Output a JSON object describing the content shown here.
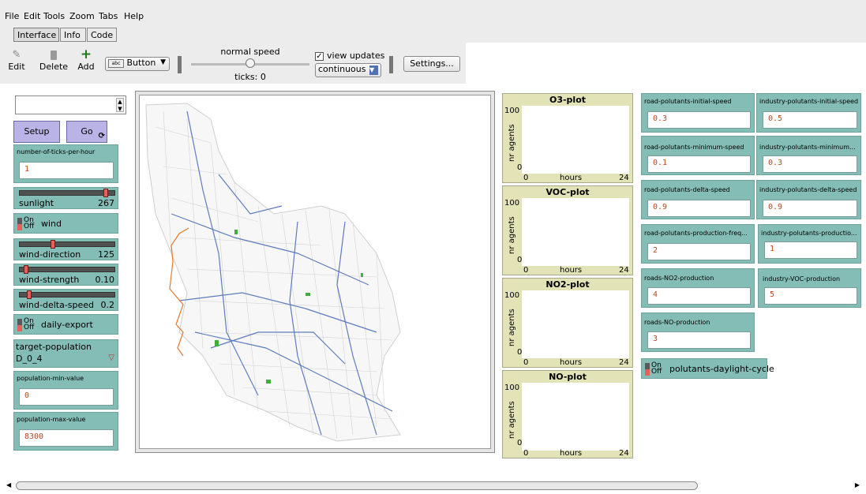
{
  "menu": [
    "File",
    "Edit",
    "Tools",
    "Zoom",
    "Tabs",
    "Help"
  ],
  "tabs": [
    "Interface",
    "Info",
    "Code"
  ],
  "toolbar": {
    "edit": "Edit",
    "delete": "Delete",
    "add": "Add",
    "widget_type": "Button",
    "speed_label": "normal speed",
    "ticks_label": "ticks: 0",
    "view_updates_label": "view updates",
    "view_updates_checked": true,
    "update_mode": "continuous",
    "settings": "Settings..."
  },
  "command_center": "",
  "buttons": {
    "setup": "Setup",
    "go": "Go"
  },
  "inputs_left": [
    {
      "label": "number-of-ticks-per-hour",
      "value": "1"
    },
    {
      "label": "population-min-value",
      "value": "0"
    },
    {
      "label": "population-max-value",
      "value": "8300"
    }
  ],
  "sliders": [
    {
      "label": "sunlight",
      "value": "267",
      "fraction": 0.9
    },
    {
      "label": "wind-direction",
      "value": "125",
      "fraction": 0.35
    },
    {
      "label": "wind-strength",
      "value": "0.10",
      "fraction": 0.05
    },
    {
      "label": "wind-delta-speed",
      "value": "0.2",
      "fraction": 0.1
    }
  ],
  "switches": {
    "on": "On",
    "off": "Off",
    "wind": "wind",
    "daily_export": "daily-export",
    "daylight_cycle": "polutants-daylight-cycle"
  },
  "chooser": {
    "label": "target-population",
    "value": "D_0_4"
  },
  "plots": [
    {
      "title": "O3-plot",
      "ymax": "100",
      "ymin": "0",
      "xmin": "0",
      "xmax": "24",
      "xlabel": "hours",
      "ylabel": "nr agents"
    },
    {
      "title": "VOC-plot",
      "ymax": "100",
      "ymin": "0",
      "xmin": "0",
      "xmax": "24",
      "xlabel": "hours",
      "ylabel": "nr agents"
    },
    {
      "title": "NO2-plot",
      "ymax": "100",
      "ymin": "0",
      "xmin": "0",
      "xmax": "24",
      "xlabel": "hours",
      "ylabel": "nr agents"
    },
    {
      "title": "NO-plot",
      "ymax": "100",
      "ymin": "0",
      "xmin": "0",
      "xmax": "24",
      "xlabel": "hours",
      "ylabel": "nr agents"
    }
  ],
  "inputs_right": [
    {
      "label": "road-polutants-initial-speed",
      "value": "0.3"
    },
    {
      "label": "industry-polutants-initial-speed",
      "value": "0.5"
    },
    {
      "label": "road-polutants-minimum-speed",
      "value": "0.1"
    },
    {
      "label": "industry-polutants-minimum...",
      "value": "0.3"
    },
    {
      "label": "road-polutants-delta-speed",
      "value": "0.9"
    },
    {
      "label": "industry-polutants-delta-speed",
      "value": "0.9"
    },
    {
      "label": "road-polutants-production-freq...",
      "value": "2"
    },
    {
      "label": "industry-polutants-productio...",
      "value": "1"
    },
    {
      "label": "roads-NO2-production",
      "value": "4"
    },
    {
      "label": "industry-VOC-production",
      "value": "5"
    },
    {
      "label": "roads-NO-production",
      "value": "3"
    }
  ],
  "colors": {
    "widget": "#84bdb6",
    "button": "#b9b3e6",
    "plot": "#e2e3b6",
    "roads": "#5e7bbd",
    "parks": "#3fae3a",
    "boundary": "#e8792a"
  }
}
